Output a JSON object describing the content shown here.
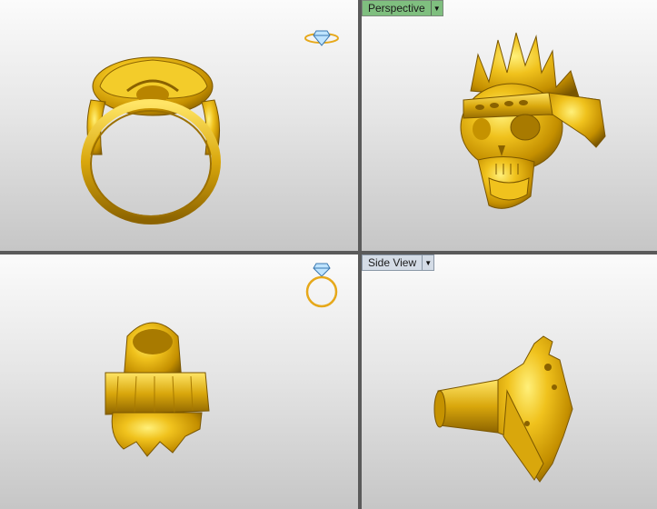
{
  "viewports": {
    "top_right": {
      "label": "Perspective",
      "dropdown_icon": "chevron-down-icon"
    },
    "bottom_right": {
      "label": "Side View",
      "dropdown_icon": "chevron-down-icon"
    }
  },
  "colors": {
    "gold": "#e6b81a",
    "gold_dark": "#8a6200",
    "gold_light": "#ffe36a",
    "active_label_bg": "#7fbf7f",
    "inactive_label_bg": "#d4dce6",
    "viewport_separator": "#5a5a5a"
  },
  "icons": {
    "top_left_orientation": "ring-side-orientation-icon",
    "bottom_left_orientation": "ring-front-orientation-icon"
  }
}
